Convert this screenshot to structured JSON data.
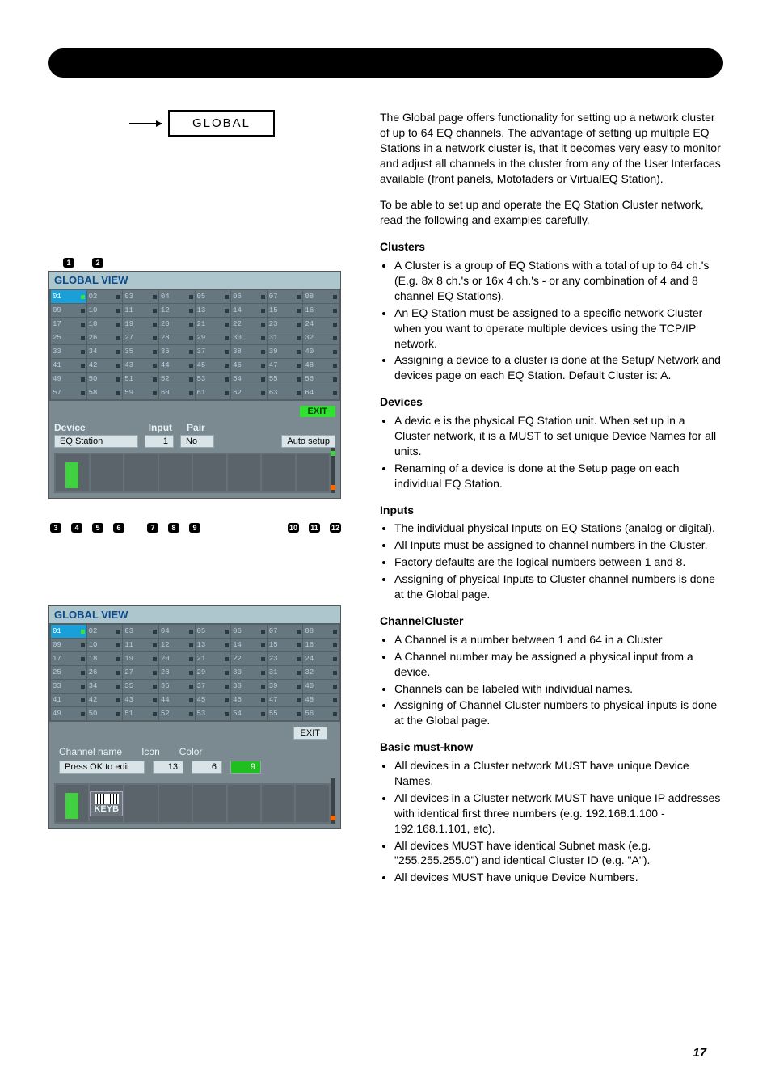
{
  "header": {
    "global_label": "GLOBAL"
  },
  "intro": {
    "p1": "The Global page offers functionality for setting up a network cluster of up to 64 EQ channels. The advantage of setting up multiple EQ Stations in a network cluster is, that it becomes very easy to monitor and adjust all channels in the cluster from any of the User Interfaces available (front panels, Motofaders or VirtualEQ Station).",
    "p2": "To be able to set up and operate the EQ Station Cluster network, read the following and examples carefully."
  },
  "clusters": {
    "title": "Clusters",
    "items": [
      "A Cluster is a group of EQ Stations with a total of up to 64 ch.'s (E.g. 8x 8 ch.'s or 16x 4 ch.'s - or any combination of 4 and 8 channel EQ Stations).",
      "An EQ Station must be assigned to a specific network Cluster when you want to operate multiple devices using the TCP/IP network.",
      "Assigning a device to a cluster is done at the Setup/ Network and devices page on each EQ Station. Default Cluster is: A."
    ]
  },
  "devices": {
    "title": "Devices",
    "items": [
      "A devic e is the physical EQ Station unit. When set up in a Cluster network, it is a MUST to set unique Device Names for all units.",
      "Renaming of a device is done at the Setup page on each individual EQ Station."
    ]
  },
  "inputs": {
    "title": "Inputs",
    "items": [
      "The individual physical Inputs on EQ Stations (analog or digital).",
      "All Inputs must be assigned to channel numbers in the Cluster.",
      "Factory defaults are the logical numbers between 1 and 8.",
      "Assigning of physical Inputs to Cluster channel numbers is done at the Global page."
    ]
  },
  "channels": {
    "title": "ChannelCluster",
    "items": [
      "A Channel is a number between 1 and 64 in a Cluster",
      "A Channel number may be assigned a physical input from a device.",
      "Channels can be labeled with individual names.",
      "Assigning of Channel Cluster numbers to physical inputs is done at the Global page."
    ]
  },
  "basic": {
    "title": "Basic must-know",
    "items": [
      "All devices in a Cluster network MUST have unique Device Names.",
      "All devices in a Cluster network MUST have unique IP addresses with identical first three numbers (e.g. 192.168.1.100 - 192.168.1.101, etc).",
      "All devices MUST have identical Subnet mask (e.g. \"255.255.255.0\") and identical Cluster ID (e.g. \"A\").",
      "All devices MUST have unique Device Numbers."
    ]
  },
  "shot1": {
    "title": "GLOBAL VIEW",
    "exit": "EXIT",
    "labels": {
      "device": "Device",
      "input": "Input",
      "pair": "Pair"
    },
    "values": {
      "device": "EQ Station",
      "input": "1",
      "pair": "No",
      "auto": "Auto setup"
    },
    "top_badges": [
      "1",
      "2"
    ],
    "bottom_badges_left": [
      "3",
      "4",
      "5",
      "6",
      "7",
      "8",
      "9"
    ],
    "bottom_badges_right": [
      "10",
      "11",
      "12"
    ]
  },
  "shot2": {
    "title": "GLOBAL VIEW",
    "exit": "EXIT",
    "labels": {
      "chname": "Channel name",
      "icon": "Icon",
      "color": "Color"
    },
    "values": {
      "chname": "Press OK to edit",
      "icon": "13",
      "color": "6",
      "extra": "9"
    },
    "keyb": "KEYB"
  },
  "cells": [
    "01",
    "02",
    "03",
    "04",
    "05",
    "06",
    "07",
    "08",
    "09",
    "10",
    "11",
    "12",
    "13",
    "14",
    "15",
    "16",
    "17",
    "18",
    "19",
    "20",
    "21",
    "22",
    "23",
    "24",
    "25",
    "26",
    "27",
    "28",
    "29",
    "30",
    "31",
    "32",
    "33",
    "34",
    "35",
    "36",
    "37",
    "38",
    "39",
    "40",
    "41",
    "42",
    "43",
    "44",
    "45",
    "46",
    "47",
    "48",
    "49",
    "50",
    "51",
    "52",
    "53",
    "54",
    "55",
    "56",
    "57",
    "58",
    "59",
    "60",
    "61",
    "62",
    "63",
    "64"
  ],
  "page_number": "17"
}
